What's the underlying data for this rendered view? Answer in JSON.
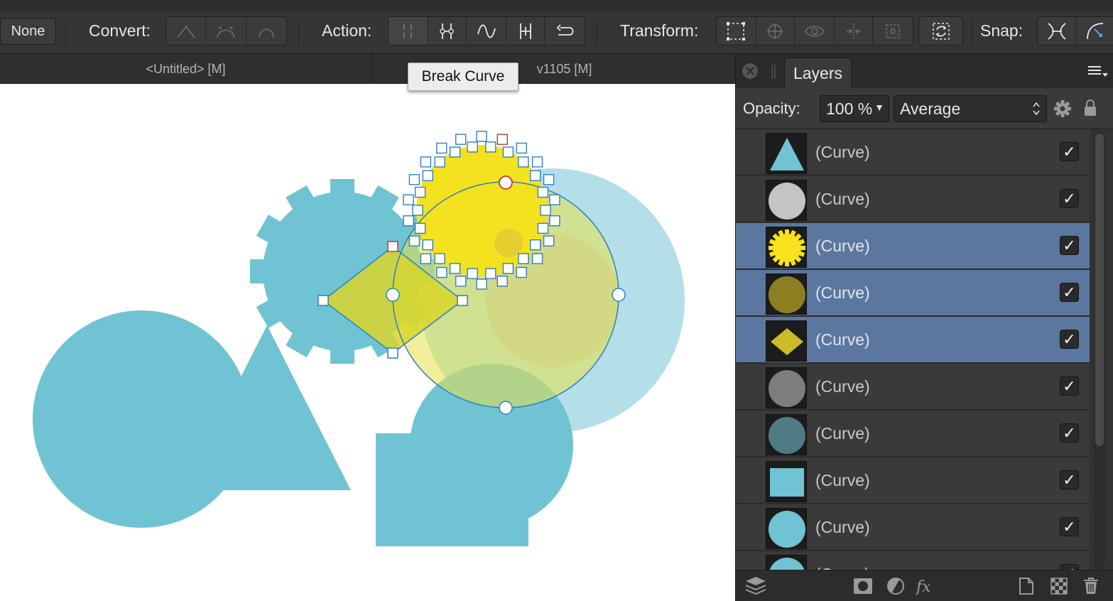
{
  "toolbar": {
    "none_label": "None",
    "convert_label": "Convert:",
    "action_label": "Action:",
    "transform_label": "Transform:",
    "snap_label": "Snap:",
    "convert_icons": [
      "sharp-corner-icon",
      "smooth-curve-icon",
      "smart-curve-icon"
    ],
    "action_icons": [
      "break-curve-icon",
      "close-curve-icon",
      "smooth-curve-icon",
      "join-curves-icon",
      "reverse-curve-icon"
    ],
    "transform_icons": [
      "transform-bounds-icon",
      "rotation-center-icon",
      "show-eye-icon",
      "mirror-icon",
      "transform-origin-icon",
      "transform-mode-icon"
    ],
    "snap_icons": [
      "snap-to-curve-icon",
      "snap-to-geometry-icon"
    ]
  },
  "tabs": {
    "doc1": "<Untitled> [M]",
    "doc2": "v1105  [M]"
  },
  "tooltip": {
    "text": "Break Curve"
  },
  "panel": {
    "title": "Layers",
    "opacity_label": "Opacity:",
    "opacity_value": "100 %",
    "blend_mode": "Average",
    "layers": [
      {
        "name": "(Curve)",
        "thumb": "triangle",
        "color": "#6fc3d3",
        "selected": false,
        "visible": "✓"
      },
      {
        "name": "(Curve)",
        "thumb": "circle",
        "color": "#c4c4c4",
        "selected": false,
        "visible": "✓"
      },
      {
        "name": "(Curve)",
        "thumb": "gear",
        "color": "#f7e21b",
        "selected": true,
        "visible": "✓"
      },
      {
        "name": "(Curve)",
        "thumb": "circle",
        "color": "#8c7f22",
        "selected": true,
        "visible": "✓"
      },
      {
        "name": "(Curve)",
        "thumb": "diamond",
        "color": "#cdbb25",
        "selected": true,
        "visible": "✓"
      },
      {
        "name": "(Curve)",
        "thumb": "circle",
        "color": "#7d7d7d",
        "selected": false,
        "visible": "✓"
      },
      {
        "name": "(Curve)",
        "thumb": "circle",
        "color": "#4f7b85",
        "selected": false,
        "visible": "✓"
      },
      {
        "name": "(Curve)",
        "thumb": "square",
        "color": "#6fc3d3",
        "selected": false,
        "visible": "✓"
      },
      {
        "name": "(Curve)",
        "thumb": "circle",
        "color": "#6fc3d3",
        "selected": false,
        "visible": "✓"
      },
      {
        "name": "(Curve)",
        "thumb": "circle",
        "color": "#6fc3d3",
        "selected": false,
        "visible": "✓"
      }
    ]
  },
  "colors": {
    "accent_selection": "#5b779f",
    "shape_blue": "#6fc3d3",
    "shape_yellow": "#f7e21b",
    "handle_blue": "#2f7fbf",
    "handle_red": "#c0392b"
  }
}
